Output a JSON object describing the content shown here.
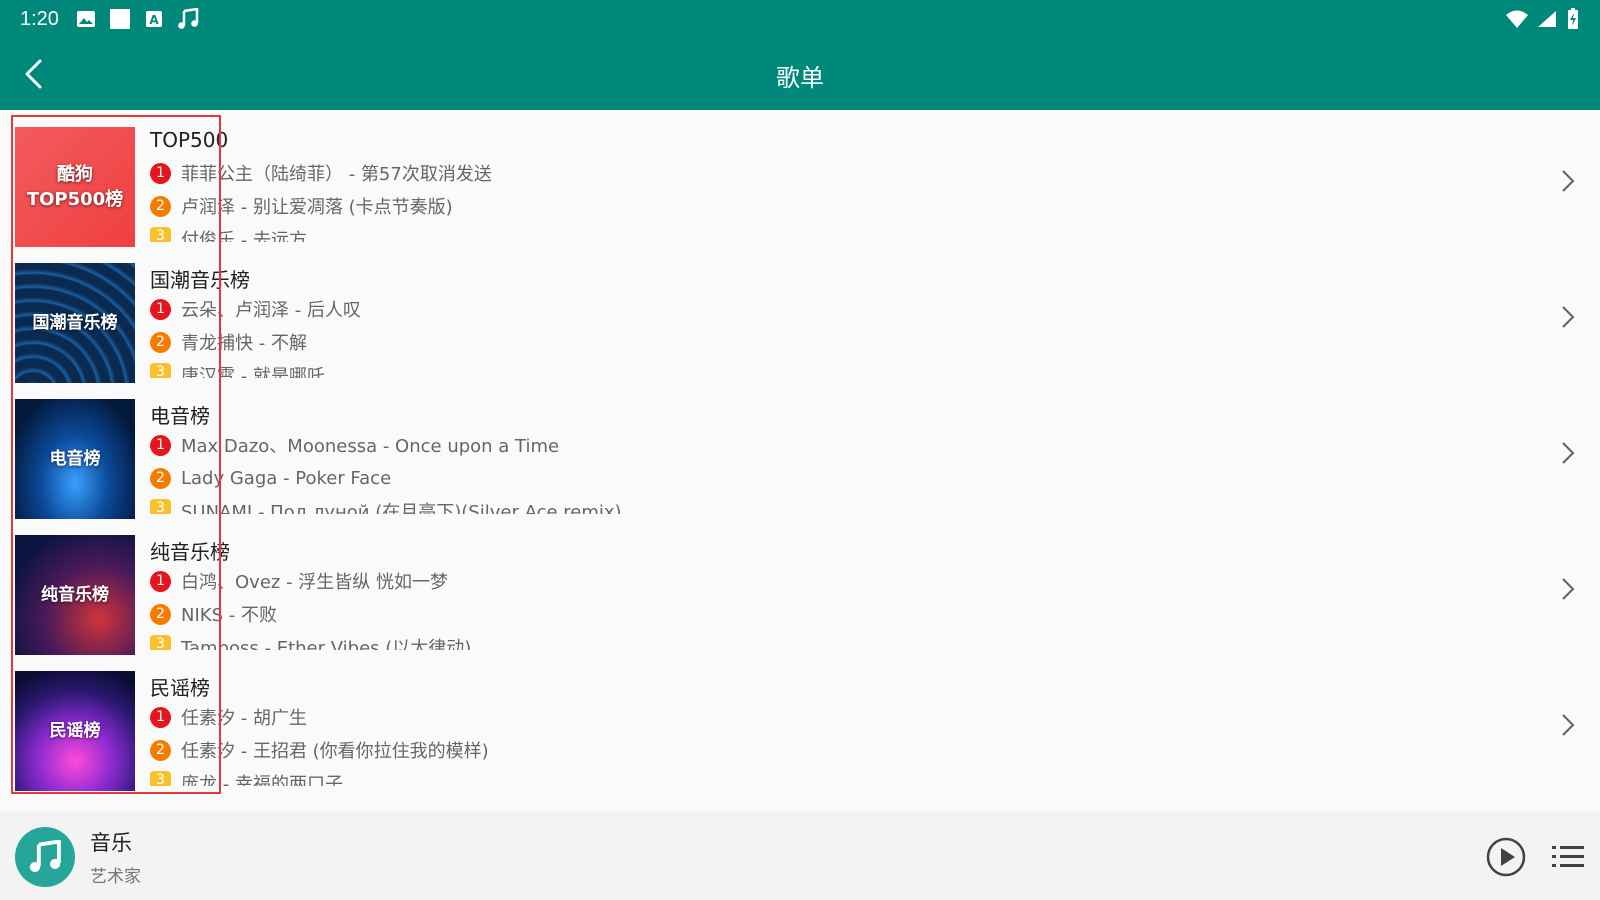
{
  "status_bar": {
    "time": "1:20",
    "left_icons": [
      "image-icon",
      "square-icon",
      "a-box-icon",
      "music-note-icon"
    ],
    "right_icons": [
      "wifi-icon",
      "signal-icon",
      "battery-icon"
    ]
  },
  "app_bar": {
    "title": "歌单",
    "back_icon": "back-arrow-icon"
  },
  "playlists": [
    {
      "cover_text": "酷狗\nTOP500榜",
      "title": "TOP500",
      "tracks": [
        "菲菲公主（陆绮菲） - 第57次取消发送",
        "卢润泽 - 别让爱凋落 (卡点节奏版)",
        "付俊乐 - 去远方"
      ]
    },
    {
      "cover_text": "国潮音乐榜",
      "title": "国潮音乐榜",
      "tracks": [
        "云朵、卢润泽 - 后人叹",
        "青龙捕快 - 不解",
        "唐汉霄 - 就是哪吒"
      ]
    },
    {
      "cover_text": "电音榜",
      "title": "电音榜",
      "tracks": [
        "Max Dazo、Moonessa - Once upon a Time",
        "Lady Gaga - Poker Face",
        "SUNAMI - Под луной (在月亮下)(Silver Ace remix)"
      ]
    },
    {
      "cover_text": "纯音乐榜",
      "title": "纯音乐榜",
      "tracks": [
        "白鸿、Ovez - 浮生皆纵 恍如一梦",
        "NIKS - 不败",
        "Tamboss - Ether Vibes (以太律动)"
      ]
    },
    {
      "cover_text": "民谣榜",
      "title": "民谣榜",
      "tracks": [
        "任素汐 - 胡广生",
        "任素汐 - 王招君 (你看你拉住我的模样)",
        "庞龙 - 幸福的两口子"
      ]
    }
  ],
  "ranks": [
    "1",
    "2",
    "3"
  ],
  "player": {
    "title": "音乐",
    "artist": "艺术家",
    "art_icon": "music-note-icon",
    "play_icon": "play-circle-icon",
    "queue_icon": "queue-list-icon"
  },
  "colors": {
    "primary": "#00897b",
    "rank_1": "#e8141b",
    "rank_2": "#f57c00",
    "rank_3": "#fbc02d",
    "highlight": "#e53935"
  }
}
